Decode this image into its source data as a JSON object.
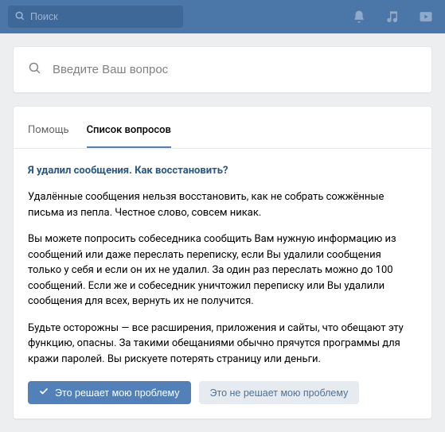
{
  "topbar": {
    "search_placeholder": "Поиск"
  },
  "ask": {
    "placeholder": "Введите Ваш вопрос"
  },
  "tabs": {
    "items": [
      {
        "label": "Помощь"
      },
      {
        "label": "Список вопросов"
      }
    ],
    "active_index": 1
  },
  "article": {
    "title": "Я удалил сообщения. Как восстановить?",
    "paragraphs": [
      "Удалённые сообщения нельзя восстановить, как не собрать сожжённые письма из пепла. Честное слово, совсем никак.",
      "Вы можете попросить собеседника сообщить Вам нужную информацию из сообщений или даже переслать переписку, если Вы удалили сообщения только у себя и если он их не удалил. За один раз переслать можно до 100 сообщений. Если же и собеседник уничтожил переписку или Вы удалили сообщения для всех, вернуть их не получится.",
      "Будьте осторожны — все расширения, приложения и сайты, что обещают эту функцию, опасны. За такими обещаниями обычно прячутся программы для кражи паролей. Вы рискуете потерять страницу или деньги."
    ]
  },
  "buttons": {
    "solves": "Это решает мою проблему",
    "not_solves": "Это не решает мою проблему"
  }
}
